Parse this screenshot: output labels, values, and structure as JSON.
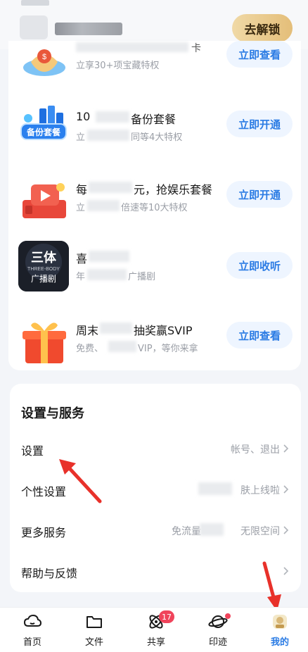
{
  "header": {
    "unlock_label": "去解锁"
  },
  "promos": [
    {
      "title": "",
      "title_tail": "卡",
      "subtitle": "立享30+项宝藏特权",
      "button": "立即查看",
      "icon": "gift-bag-icon"
    },
    {
      "title": "10",
      "title_tail": "备份套餐",
      "subtitle_head": "立",
      "subtitle_tail": "同等4大特权",
      "button": "立即开通",
      "icon": "backup-package-icon",
      "icon_text": "备份套餐"
    },
    {
      "title": "每",
      "title_tail": "元，抢娱乐套餐",
      "subtitle_head": "立",
      "subtitle_tail": "倍速等10大特权",
      "button": "立即开通",
      "icon": "video-play-icon"
    },
    {
      "title": "喜",
      "title_tail": "",
      "subtitle_head": "年",
      "subtitle_tail": "广播剧",
      "button": "立即收听",
      "icon": "three-body-audio-icon",
      "icon_text": "三体",
      "icon_sub": "THREE-BODY",
      "icon_bottom": "广播剧"
    },
    {
      "title": "周末",
      "title_tail": "抽奖赢SVIP",
      "subtitle_head": "免费、",
      "subtitle_tail": "VIP，等你来拿",
      "button": "立即查看",
      "icon": "red-gift-box-icon"
    }
  ],
  "settings": {
    "heading": "设置与服务",
    "rows": [
      {
        "label": "设置",
        "value": "帐号、退出"
      },
      {
        "label": "个性设置",
        "value": "皮肤上线啦",
        "value_partial": "肤上线啦"
      },
      {
        "label": "更多服务",
        "value_head": "免流量",
        "value_tail": "无限空间"
      },
      {
        "label": "帮助与反馈",
        "value": ""
      }
    ]
  },
  "nav": {
    "items": [
      {
        "label": "首页",
        "icon": "cloud-icon"
      },
      {
        "label": "文件",
        "icon": "folder-icon"
      },
      {
        "label": "共享",
        "icon": "atom-share-icon",
        "badge": "17"
      },
      {
        "label": "印迹",
        "icon": "planet-icon"
      },
      {
        "label": "我的",
        "icon": "profile-avatar-icon",
        "active": true
      }
    ]
  },
  "colors": {
    "accent": "#2a7be4",
    "badge": "#f0445b",
    "unlock_gold": "#e4be79",
    "annotation_red": "#e8312a"
  }
}
